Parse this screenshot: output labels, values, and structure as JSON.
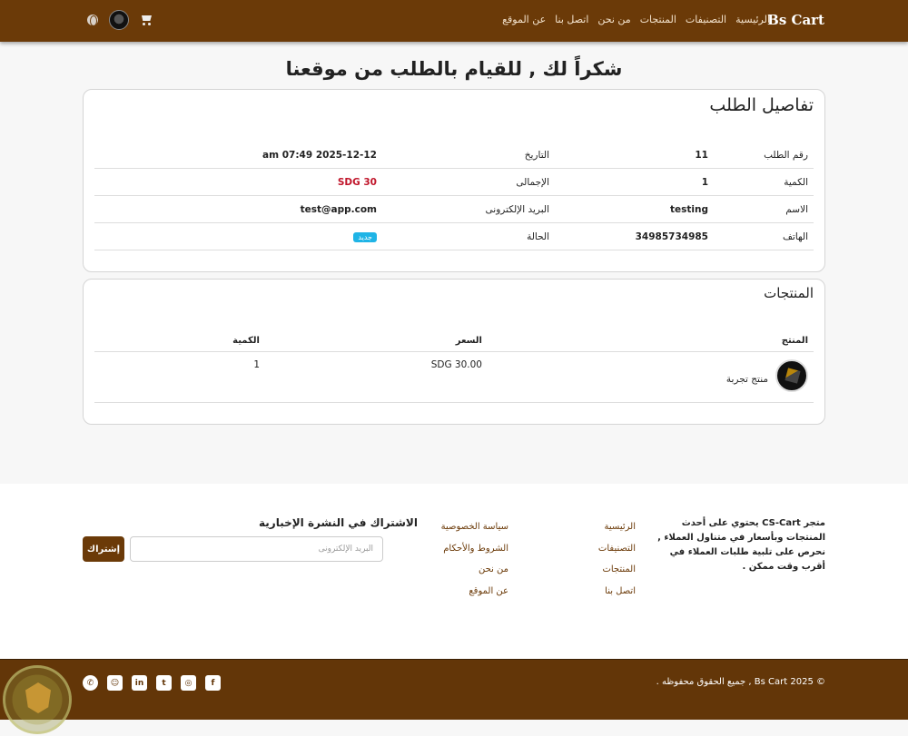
{
  "nav": {
    "brand": "Bs Cart",
    "links": [
      "الرئيسية",
      "التصنيفات",
      "المنتجات",
      "من نحن",
      "اتصل بنا",
      "عن الموقع"
    ]
  },
  "page": {
    "heading": "شكراً لك , للقيام بالطلب من موقعنا"
  },
  "order_details": {
    "title": "تفاصيل الطلب",
    "rows": [
      {
        "l1": "رقم الطلب",
        "v1": "11",
        "l2": "التاريخ",
        "v2": "2025-12-12 07:49 am"
      },
      {
        "l1": "الكمية",
        "v1": "1",
        "l2": "الإجمالى",
        "v2": "30 SDG"
      },
      {
        "l1": "الاسم",
        "v1": "testing",
        "l2": "البريد الإلكترونى",
        "v2": "test@app.com"
      },
      {
        "l1": "الهاتف",
        "v1": "34985734985",
        "l2": "الحالة",
        "v2": "جديد"
      }
    ]
  },
  "products": {
    "title": "المنتجات",
    "headers": [
      "المنتج",
      "السعر",
      "الكمية"
    ],
    "items": [
      {
        "name": "منتج تجربة",
        "price": "SDG 30.00",
        "qty": "1"
      }
    ]
  },
  "footer": {
    "about": "متجر CS-Cart يحتوي على أحدث المنتجات وبأسعار في متناول العملاء , نحرص على تلبية طلبات العملاء في أقرب وقت ممكن .",
    "links_col1": [
      "الرئيسية",
      "التصنيفات",
      "المنتجات",
      "اتصل بنا"
    ],
    "links_col2": [
      "سياسة الخصوصية",
      "الشروط والأحكام",
      "من نحن",
      "عن الموقع"
    ],
    "newsletter_title": "الاشتراك في النشرة الإخبارية",
    "email_placeholder": "البريد الإلكترونى",
    "subscribe_label": "إشتراك",
    "copyright": "© Bs Cart 2025 , جميع الحقوق محفوظه ."
  },
  "social_icons": [
    "facebook-icon",
    "instagram-icon",
    "twitter-icon",
    "linkedin-icon",
    "snapchat-icon",
    "whatsapp-icon"
  ],
  "colors": {
    "brand": "#6b3a08",
    "badge": "#1fb4e6",
    "price_red": "#c0152a"
  }
}
